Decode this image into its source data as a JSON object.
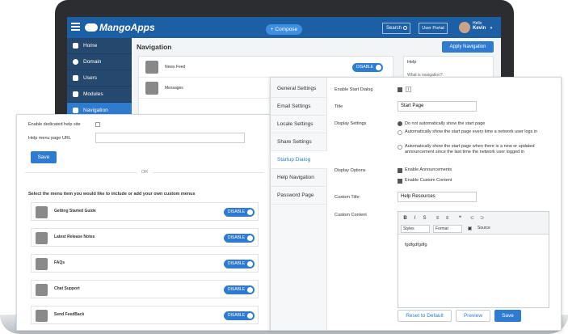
{
  "app": {
    "logo_text": "MangoApps",
    "compose_label": "+ Compose",
    "search_label": "Search",
    "portal_label": "User Portal",
    "user_greeting": "Hello",
    "user_name": "Kevin"
  },
  "sidebar": {
    "items": [
      {
        "label": "Home"
      },
      {
        "label": "Domain"
      },
      {
        "label": "Users"
      },
      {
        "label": "Modules"
      },
      {
        "label": "Navigation"
      }
    ]
  },
  "navigation_page": {
    "title": "Navigation",
    "apply_label": "Apply Navigation",
    "rows": [
      {
        "label": "News Feed",
        "toggle": "DISABLE"
      },
      {
        "label": "Messages"
      }
    ],
    "help": {
      "title": "Help",
      "question": "What is navigation?"
    }
  },
  "help_site_panel": {
    "enable_label": "Enable dedicated help site",
    "url_label": "Help menu page URL",
    "url_value": "",
    "save_label": "Save",
    "or_label": "OR",
    "menu_title": "Select the menu item you would like to include or add your own custom menus",
    "menu_items": [
      {
        "label": "Getting Started Guide",
        "toggle": "DISABLE"
      },
      {
        "label": "Latest Release Notes",
        "toggle": "DISABLE"
      },
      {
        "label": "FAQs",
        "toggle": "DISABLE"
      },
      {
        "label": "Chat Support",
        "toggle": "DISABLE"
      },
      {
        "label": "Send FeedBack",
        "toggle": "DISABLE"
      }
    ]
  },
  "startup_panel": {
    "tabs": [
      {
        "label": "General Settings"
      },
      {
        "label": "Email Settings"
      },
      {
        "label": "Locale Settings"
      },
      {
        "label": "Share Settings"
      },
      {
        "label": "Startup Dialog"
      },
      {
        "label": "Help Navigation"
      },
      {
        "label": "Password Page"
      }
    ],
    "enable_label": "Enable Start Dialog",
    "title_label": "Title",
    "title_value": "Start Page",
    "display_settings_label": "Display Settings",
    "display_options": [
      "Do not automatically show the start page",
      "Automatically show the start page every time a network user logs in",
      "Automatically show the start page when there is a new or updated announcement since the last time the network user logged in"
    ],
    "display_options_label": "Display Options",
    "checkbox_options": [
      "Enable Announcements",
      "Enable Custom Content"
    ],
    "custom_title_label": "Custom Title:",
    "custom_title_value": "Help Resources",
    "custom_content_label": "Custom Content",
    "editor": {
      "styles_label": "Styles",
      "format_label": "Format",
      "source_label": "Source",
      "content": "fgdfgdfgdfg"
    },
    "reset_label": "Reset to Default",
    "preview_label": "Preview",
    "save_label": "Save"
  }
}
